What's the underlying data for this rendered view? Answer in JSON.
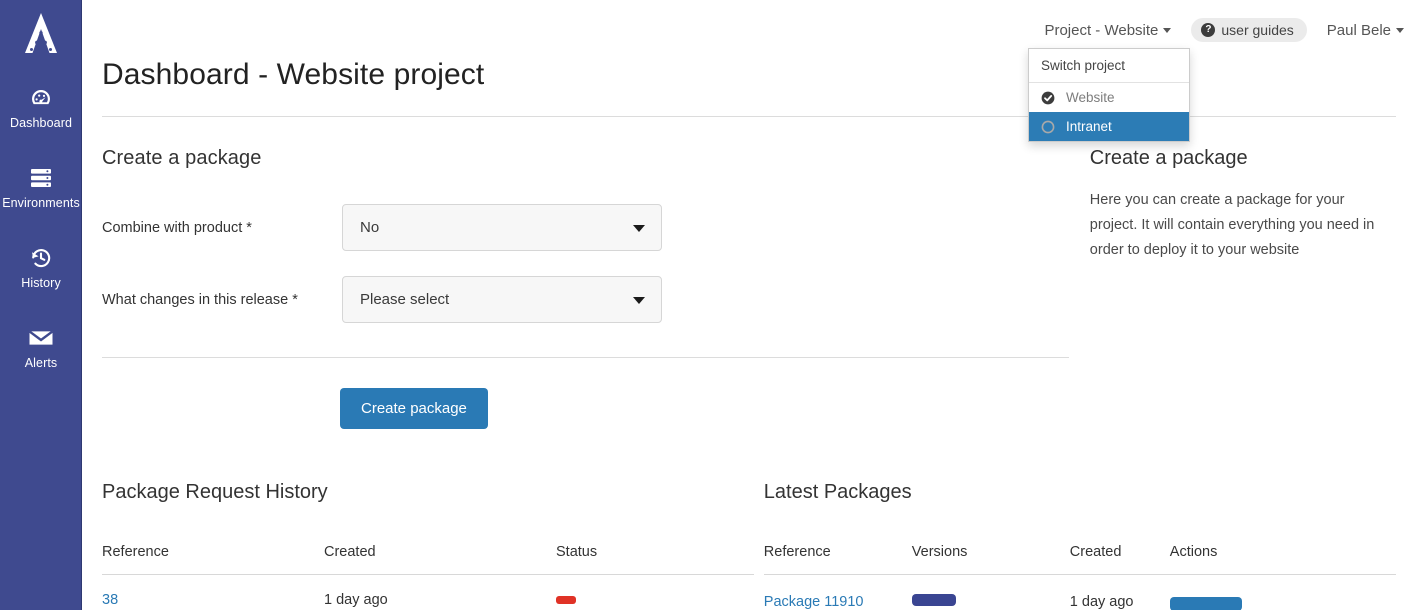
{
  "sidebar": {
    "logo_name": "apex-logo",
    "items": [
      {
        "label": "Dashboard",
        "icon": "gauge-icon"
      },
      {
        "label": "Environments",
        "icon": "server-stack-icon"
      },
      {
        "label": "History",
        "icon": "history-clock-icon"
      },
      {
        "label": "Alerts",
        "icon": "envelope-icon"
      }
    ],
    "background": "#3f4a8f"
  },
  "topbar": {
    "project_switcher_label": "Project - Website",
    "user_guides_label": "user guides",
    "user_guides_icon": "question-circle-icon",
    "user_name": "Paul Bele"
  },
  "project_dropdown": {
    "header": "Switch project",
    "items": [
      {
        "label": "Website",
        "state": "selected",
        "icon": "check-circle-icon"
      },
      {
        "label": "Intranet",
        "state": "active",
        "icon": "radio-circle-icon"
      }
    ],
    "active_color": "#2c7cb5"
  },
  "page": {
    "title": "Dashboard - Website project"
  },
  "create_package": {
    "section_title": "Create a package",
    "fields": [
      {
        "label": "Combine with product",
        "required": "*",
        "value": "No"
      },
      {
        "label": "What changes in this release",
        "required": "*",
        "value": "Please select"
      }
    ],
    "submit_label": "Create package",
    "accent": "#2a7ab5"
  },
  "aside": {
    "title": "Create a package",
    "body": "Here you can create a package for your project. It will contain everything you need in order to deploy it to your website"
  },
  "package_request_history": {
    "title": "Package Request History",
    "columns": [
      "Reference",
      "Created",
      "Status"
    ],
    "rows": [
      {
        "reference": "38",
        "created": "1 day ago",
        "status": ""
      }
    ]
  },
  "latest_packages": {
    "title": "Latest Packages",
    "columns": [
      "Reference",
      "Versions",
      "Created",
      "Actions"
    ],
    "rows": [
      {
        "reference": "Package 11910",
        "versions": "",
        "created": "1 day ago",
        "action": ""
      }
    ]
  }
}
